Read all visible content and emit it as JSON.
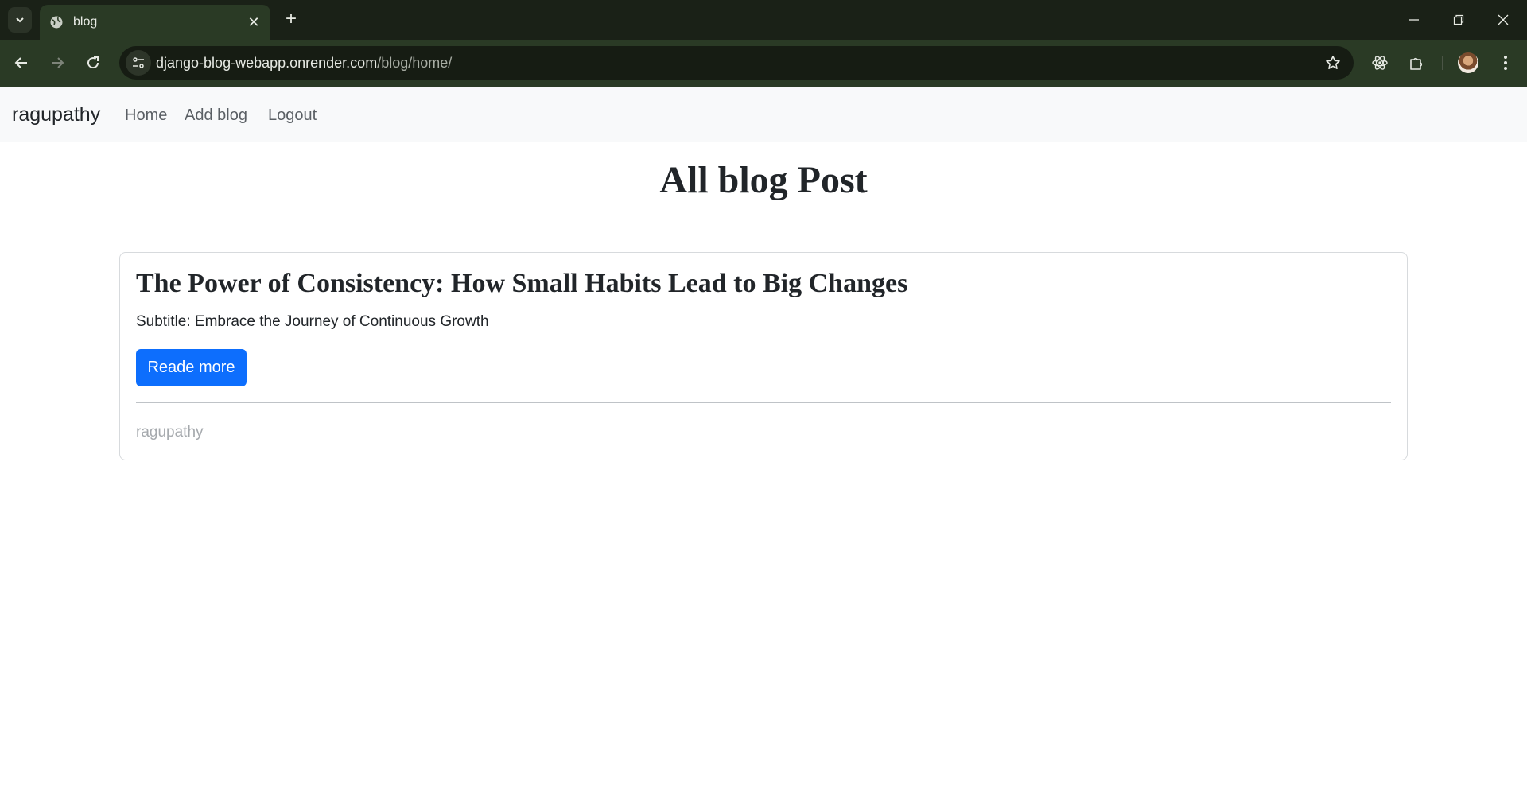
{
  "browser": {
    "tab_title": "blog",
    "url_domain": "django-blog-webapp.onrender.com",
    "url_path": "/blog/home/"
  },
  "navbar": {
    "brand": "ragupathy",
    "links": [
      "Home",
      "Add blog",
      "Logout"
    ]
  },
  "main": {
    "heading": "All blog Post",
    "posts": [
      {
        "title": "The Power of Consistency: How Small Habits Lead to Big Changes",
        "subtitle": "Subtitle: Embrace the Journey of Continuous Growth",
        "button_label": "Reade more",
        "author": "ragupathy"
      }
    ]
  },
  "colors": {
    "primary_button": "#0d6efd",
    "navbar_bg": "#f8f9fa",
    "browser_frame": "#2a3a25"
  },
  "icons": [
    "tab-search-icon",
    "globe-icon",
    "close-icon",
    "plus-icon",
    "minimize-icon",
    "restore-icon",
    "back-icon",
    "forward-icon",
    "reload-icon",
    "site-info-icon",
    "star-icon",
    "react-devtools-icon",
    "extensions-icon",
    "profile-avatar",
    "more-icon"
  ]
}
